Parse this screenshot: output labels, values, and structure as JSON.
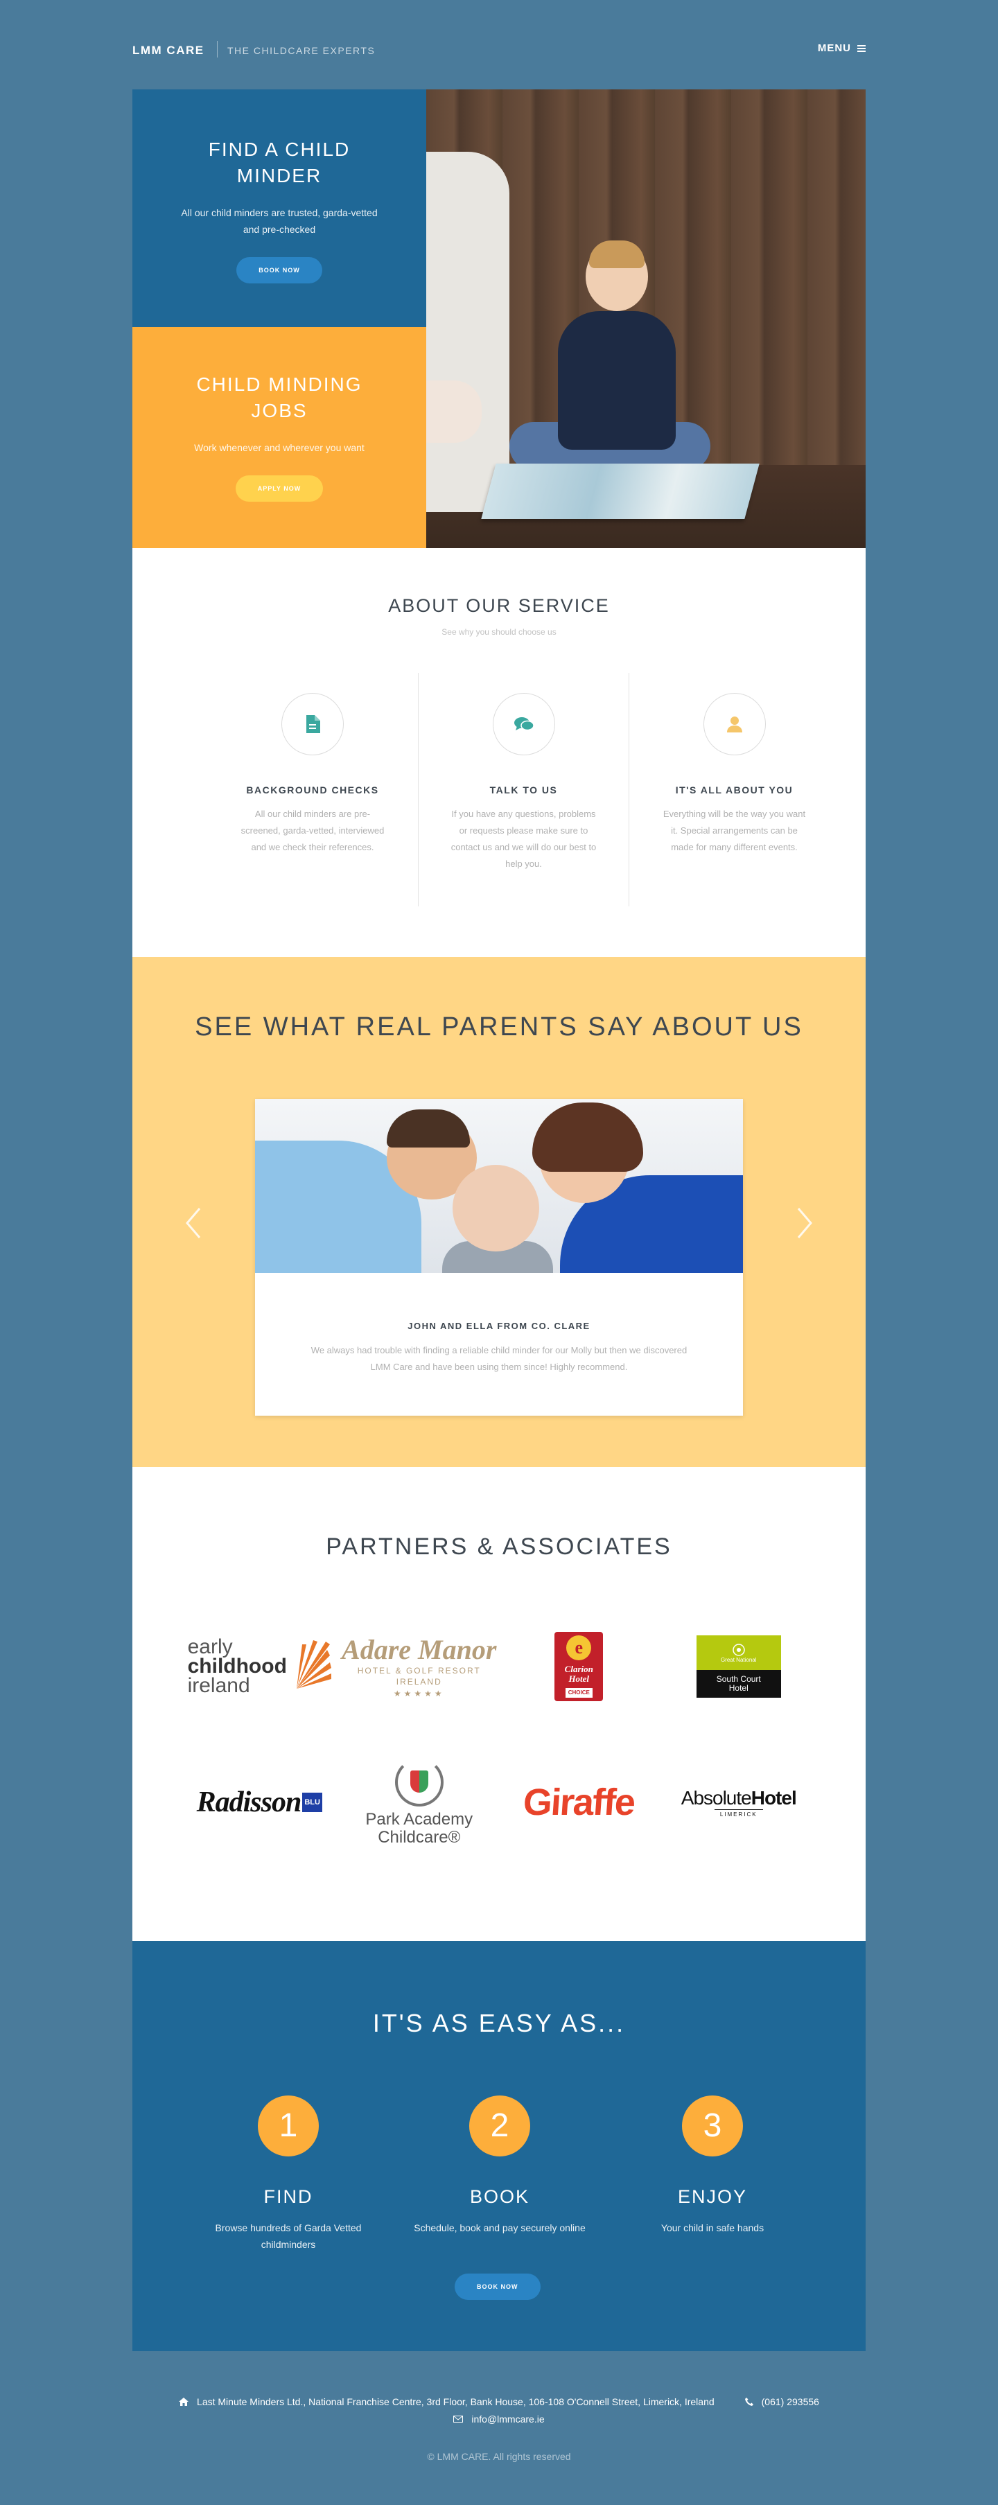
{
  "header": {
    "brand": "LMM CARE",
    "tagline": "THE CHILDCARE EXPERTS",
    "menu_label": "MENU",
    "menu_icon": "hamburger-icon"
  },
  "hero": {
    "find": {
      "title": "FIND A CHILD MINDER",
      "desc": "All our child minders are trusted, garda-vetted and pre-checked",
      "button": "BOOK NOW"
    },
    "jobs": {
      "title": "CHILD MINDING JOBS",
      "desc": "Work whenever and wherever you want",
      "button": "APPLY NOW"
    }
  },
  "about": {
    "title": "ABOUT OUR SERVICE",
    "subtitle": "See why you should choose us",
    "features": [
      {
        "icon": "document-icon",
        "color": "#3aa89f",
        "title": "BACKGROUND CHECKS",
        "text": "All our child minders are pre-screened, garda-vetted, interviewed and we check their references."
      },
      {
        "icon": "chat-icon",
        "color": "#3aa89f",
        "title": "TALK TO US",
        "text": "If you have any questions, problems or requests please make sure to contact us and we will do our best to help you."
      },
      {
        "icon": "user-icon",
        "color": "#f5c66a",
        "title": "IT'S ALL ABOUT YOU",
        "text": "Everything will be the way you want it. Special arrangements can be made for many different events."
      }
    ]
  },
  "testimonials": {
    "title": "SEE WHAT REAL PARENTS SAY ABOUT US",
    "name": "JOHN AND ELLA FROM CO. CLARE",
    "quote": "We always had trouble with finding a reliable child minder for our Molly but then we discovered LMM Care and have been using them since! Highly recommend."
  },
  "partners": {
    "title": "PARTNERS & ASSOCIATES",
    "logos": {
      "ecsi_line1": "early",
      "ecsi_line2": "childhood",
      "ecsi_line3": "ireland",
      "adare_name": "Adare Manor",
      "adare_sub1": "HOTEL & GOLF RESORT",
      "adare_sub2": "IRELAND",
      "adare_stars": "★★★★★",
      "clarion_e": "e",
      "clarion_name1": "Clarion",
      "clarion_name2": "Hotel",
      "clarion_choice": "CHOICE",
      "south_brand": "Great National",
      "south_name1": "South Court",
      "south_name2": "Hotel",
      "radisson_name": "Radisson",
      "radisson_blu": "BLU",
      "park_name1": "Park Academy",
      "park_name2": "Childcare®",
      "giraffe": "Giraffe",
      "absolute_a": "Absolute",
      "absolute_b": "Hotel",
      "absolute_sub": "LIMERICK"
    }
  },
  "steps": {
    "title": "IT'S AS EASY AS...",
    "items": [
      {
        "num": "1",
        "title": "FIND",
        "text": "Browse hundreds of Garda Vetted childminders"
      },
      {
        "num": "2",
        "title": "BOOK",
        "text": "Schedule, book and pay securely online"
      },
      {
        "num": "3",
        "title": "ENJOY",
        "text": "Your child in safe hands"
      }
    ],
    "button": "BOOK NOW"
  },
  "footer": {
    "address": "Last Minute Minders Ltd., National Franchise Centre, 3rd Floor, Bank House, 106-108 O'Connell Street, Limerick, Ireland",
    "phone": "(061) 293556",
    "email": "info@lmmcare.ie",
    "copyright": "© LMM CARE. All rights reserved"
  },
  "colors": {
    "page_bg": "#4a7b9b",
    "blue": "#1f6897",
    "orange": "#fdae3b",
    "testimonial_bg": "#ffd685"
  }
}
